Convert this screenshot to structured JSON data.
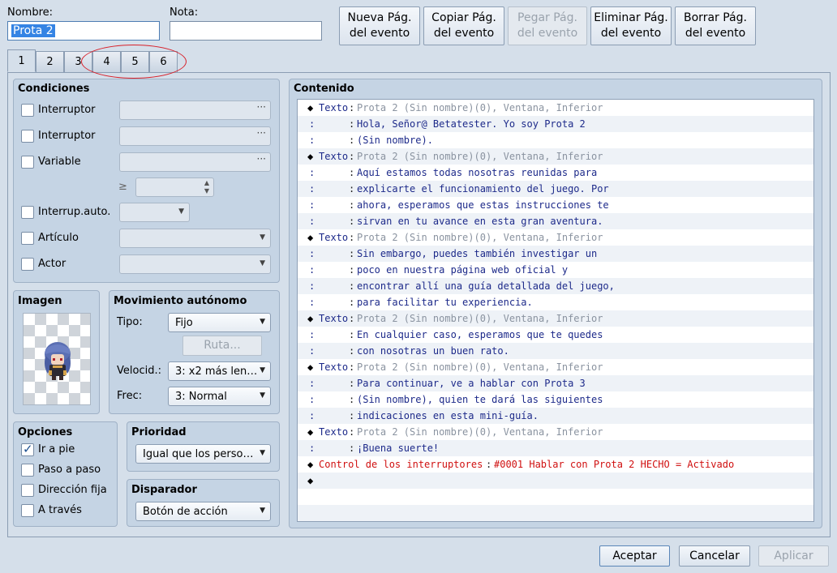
{
  "header": {
    "name_label": "Nombre:",
    "name_value": "Prota 2",
    "note_label": "Nota:",
    "note_value": ""
  },
  "page_buttons": {
    "new": [
      "Nueva Pág.",
      "del evento"
    ],
    "copy": [
      "Copiar Pág.",
      "del evento"
    ],
    "paste": [
      "Pegar Pág.",
      "del evento"
    ],
    "delete": [
      "Eliminar Pág.",
      "del evento"
    ],
    "clear": [
      "Borrar Pág.",
      "del evento"
    ]
  },
  "tabs": [
    "1",
    "2",
    "3",
    "4",
    "5",
    "6"
  ],
  "conditions": {
    "title": "Condiciones",
    "switch1": "Interruptor",
    "switch2": "Interruptor",
    "variable": "Variable",
    "gte": "≥",
    "self_switch": "Interrup.auto.",
    "item": "Artículo",
    "actor": "Actor",
    "dots": "···"
  },
  "image": {
    "title": "Imagen"
  },
  "autonomous": {
    "title": "Movimiento autónomo",
    "type_label": "Tipo:",
    "type_value": "Fijo",
    "route_button": "Ruta...",
    "speed_label": "Velocid.:",
    "speed_value": "3: x2 más len…",
    "freq_label": "Frec:",
    "freq_value": "3: Normal"
  },
  "options": {
    "title": "Opciones",
    "walk": "Ir a pie",
    "step": "Paso a paso",
    "dir_fix": "Dirección fija",
    "through": "A través"
  },
  "priority": {
    "title": "Prioridad",
    "value": "Igual que los perso…"
  },
  "trigger": {
    "title": "Disparador",
    "value": "Botón de acción"
  },
  "contents": {
    "title": "Contenido",
    "rows": [
      {
        "mark": "◆",
        "cmd": "Texto",
        "colon": ":",
        "text": "Prota 2 (Sin nombre)(0), Ventana, Inferior",
        "style": "meta"
      },
      {
        "mark": "",
        "cmd": ":",
        "colon": ":",
        "text": "Hola, Señor@ Betatester. Yo soy Prota 2",
        "style": ""
      },
      {
        "mark": "",
        "cmd": ":",
        "colon": ":",
        "text": "(Sin nombre).",
        "style": ""
      },
      {
        "mark": "◆",
        "cmd": "Texto",
        "colon": ":",
        "text": "Prota 2 (Sin nombre)(0), Ventana, Inferior",
        "style": "meta"
      },
      {
        "mark": "",
        "cmd": ":",
        "colon": ":",
        "text": "Aquí estamos todas nosotras reunidas para",
        "style": ""
      },
      {
        "mark": "",
        "cmd": ":",
        "colon": ":",
        "text": "explicarte el funcionamiento del juego. Por",
        "style": ""
      },
      {
        "mark": "",
        "cmd": ":",
        "colon": ":",
        "text": "ahora, esperamos que estas instrucciones te",
        "style": ""
      },
      {
        "mark": "",
        "cmd": ":",
        "colon": ":",
        "text": "sirvan en tu avance en esta gran aventura.",
        "style": ""
      },
      {
        "mark": "◆",
        "cmd": "Texto",
        "colon": ":",
        "text": "Prota 2 (Sin nombre)(0), Ventana, Inferior",
        "style": "meta"
      },
      {
        "mark": "",
        "cmd": ":",
        "colon": ":",
        "text": "Sin embargo, puedes también investigar un",
        "style": ""
      },
      {
        "mark": "",
        "cmd": ":",
        "colon": ":",
        "text": "poco en nuestra página web oficial y",
        "style": ""
      },
      {
        "mark": "",
        "cmd": ":",
        "colon": ":",
        "text": "encontrar allí una guía detallada del juego,",
        "style": ""
      },
      {
        "mark": "",
        "cmd": ":",
        "colon": ":",
        "text": "para facilitar tu experiencia.",
        "style": ""
      },
      {
        "mark": "◆",
        "cmd": "Texto",
        "colon": ":",
        "text": "Prota 2 (Sin nombre)(0), Ventana, Inferior",
        "style": "meta"
      },
      {
        "mark": "",
        "cmd": ":",
        "colon": ":",
        "text": "En cualquier caso, esperamos que te quedes",
        "style": ""
      },
      {
        "mark": "",
        "cmd": ":",
        "colon": ":",
        "text": "con nosotras un buen rato.",
        "style": ""
      },
      {
        "mark": "◆",
        "cmd": "Texto",
        "colon": ":",
        "text": "Prota 2 (Sin nombre)(0), Ventana, Inferior",
        "style": "meta"
      },
      {
        "mark": "",
        "cmd": ":",
        "colon": ":",
        "text": "Para continuar, ve a hablar con Prota 3",
        "style": ""
      },
      {
        "mark": "",
        "cmd": ":",
        "colon": ":",
        "text": "(Sin nombre), quien te dará las siguientes",
        "style": ""
      },
      {
        "mark": "",
        "cmd": ":",
        "colon": ":",
        "text": "indicaciones en esta mini-guía.",
        "style": ""
      },
      {
        "mark": "◆",
        "cmd": "Texto",
        "colon": ":",
        "text": "Prota 2 (Sin nombre)(0), Ventana, Inferior",
        "style": "meta"
      },
      {
        "mark": "",
        "cmd": ":",
        "colon": ":",
        "text": "¡Buena suerte!",
        "style": ""
      },
      {
        "mark": "◆",
        "cmd": "Control de los interruptores",
        "colon": ":",
        "text": "#0001 Hablar con Prota 2 HECHO = Activado",
        "style": "red"
      },
      {
        "mark": "◆",
        "cmd": "",
        "colon": "",
        "text": "",
        "style": ""
      }
    ]
  },
  "footer": {
    "ok": "Aceptar",
    "cancel": "Cancelar",
    "apply": "Aplicar"
  },
  "colors": {
    "annotation": "#d8202a",
    "meta_text": "#8a93a0",
    "command_text": "#1d2a8a",
    "switch_text": "#d01010"
  }
}
